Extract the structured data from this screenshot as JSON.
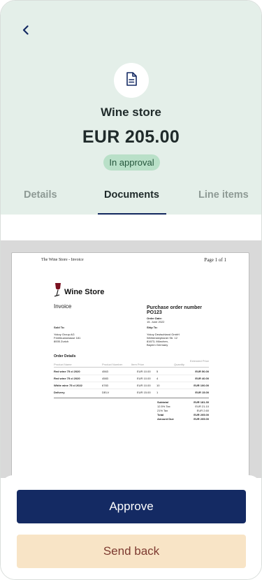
{
  "header": {
    "title": "Wine store",
    "amount": "EUR 205.00",
    "status": "In approval",
    "status_color": "#b9e0c8"
  },
  "icons": {
    "back": "back-chevron-icon",
    "document": "document-icon"
  },
  "tabs": [
    {
      "label": "Details"
    },
    {
      "label": "Documents",
      "active": true
    },
    {
      "label": "Line items"
    }
  ],
  "document": {
    "page_title": "The Wine Store - Invoice",
    "page_number": "Page 1 of 1",
    "brand": "Wine Store",
    "doc_type": "Invoice",
    "po_label": "Purchase order number",
    "po_number": "PO123",
    "order_date_label": "Order Date:",
    "order_date": "15. June 2022",
    "sold_to_label": "Sold To:",
    "sold_to": [
      "Yokoy Group AG",
      "Förrlibuckstrasse 181",
      "8005 Zurich"
    ],
    "ship_to_label": "Ship To:",
    "ship_to": [
      "Yokoy Deutschland GmbH",
      "Weihenstephaner Str. 12",
      "81673, München,",
      "Bayern Germany"
    ],
    "order_details_label": "Order Details",
    "columns": [
      "Product Name",
      "Product Number",
      "Item Price",
      "Quantity",
      "Extended Price"
    ],
    "rows": [
      {
        "name": "Red wine 75 cl 2020",
        "number": "4563",
        "price": "EUR 10.00",
        "qty": "5",
        "ext": "EUR 50.00"
      },
      {
        "name": "Red wine 75 cl 2020",
        "number": "4583",
        "price": "EUR 10.00",
        "qty": "4",
        "ext": "EUR 40.00"
      },
      {
        "name": "White wine 75 cl 2022",
        "number": "6783",
        "price": "EUR 10.00",
        "qty": "10",
        "ext": "EUR 100.00"
      },
      {
        "name": "Delivery",
        "number": "DELV",
        "price": "EUR 15.00",
        "qty": "1",
        "ext": "EUR 15.00"
      }
    ],
    "summary": [
      {
        "label": "Subtotal",
        "value": "EUR 181.30",
        "bold": true
      },
      {
        "label": "12.5% Tax",
        "value": "EUR 21.10"
      },
      {
        "label": "21% Tax",
        "value": "EUR 2.60"
      },
      {
        "label": "Total",
        "value": "EUR 205.00",
        "bold": true
      },
      {
        "label": "Amount Due",
        "value": "EUR 205.00",
        "bold": true
      }
    ]
  },
  "actions": {
    "approve_label": "Approve",
    "send_back_label": "Send back",
    "approve_color": "#142a63",
    "send_back_color": "#f8e4c6"
  }
}
